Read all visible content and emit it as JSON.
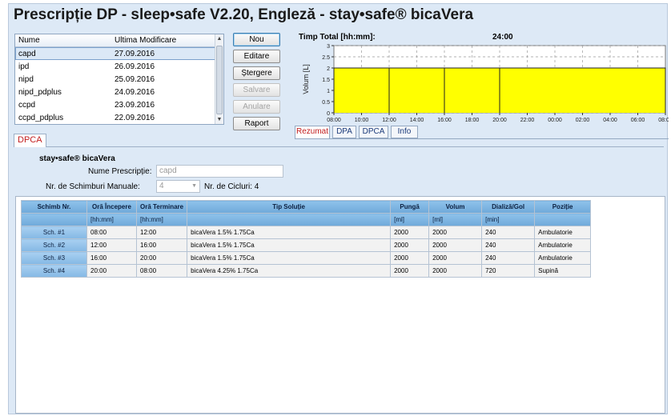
{
  "window": {
    "title": "Prescripție DP - sleep•safe V2.20, Engleză - stay•safe® bicaVera"
  },
  "prescription_list": {
    "col_name": "Nume",
    "col_modified": "Ultima Modificare",
    "rows": [
      {
        "name": "capd",
        "date": "27.09.2016"
      },
      {
        "name": "ipd",
        "date": "26.09.2016"
      },
      {
        "name": "nipd",
        "date": "25.09.2016"
      },
      {
        "name": "nipd_pdplus",
        "date": "24.09.2016"
      },
      {
        "name": "ccpd",
        "date": "23.09.2016"
      },
      {
        "name": "ccpd_pdplus",
        "date": "22.09.2016"
      }
    ]
  },
  "buttons": {
    "new": "Nou",
    "edit": "Editare",
    "delete": "Ștergere",
    "save": "Salvare",
    "cancel": "Anulare",
    "report": "Raport"
  },
  "chart": {
    "total_time_label": "Timp Total [hh:mm]:",
    "total_time_value": "24:00",
    "ylabel": "Volum [L]"
  },
  "chart_data": {
    "type": "area",
    "title": "",
    "xlabel": "",
    "ylabel": "Volum [L]",
    "x_tick_labels": [
      "08:00",
      "10:00",
      "12:00",
      "14:00",
      "16:00",
      "18:00",
      "20:00",
      "22:00",
      "00:00",
      "02:00",
      "04:00",
      "06:00",
      "08:00"
    ],
    "y_tick_labels": [
      "0",
      "0.5",
      "1",
      "1.5",
      "2",
      "2.5",
      "3"
    ],
    "ylim": [
      0,
      3
    ],
    "series": [
      {
        "values": [
          {
            "start": "08:00",
            "end": "12:00",
            "volume": 2
          },
          {
            "start": "12:00",
            "end": "16:00",
            "volume": 2
          },
          {
            "start": "16:00",
            "end": "20:00",
            "volume": 2
          },
          {
            "start": "20:00",
            "end": "08:00",
            "volume": 2
          }
        ]
      }
    ],
    "fill_color": "#ffff00",
    "grid": true
  },
  "tabs": [
    "Rezumat",
    "DPA",
    "DPCA",
    "Info"
  ],
  "mode_tab": "DPCA",
  "settings": {
    "title": "stay•safe® bicaVera",
    "name_label": "Nume Prescripție:",
    "name_value": "capd",
    "manual_label": "Nr. de Schimburi Manuale:",
    "manual_value": "4",
    "cycles_label": "Nr. de Cicluri: 4"
  },
  "exchange_table": {
    "headers": [
      "Schimb Nr.",
      "Oră Începere",
      "Oră Terminare",
      "Tip Soluție",
      "Pungă",
      "Volum",
      "Dializă/Gol",
      "Poziție"
    ],
    "units": [
      "",
      "[hh:mm]",
      "[hh:mm]",
      "",
      "[ml]",
      "[ml]",
      "[min]",
      ""
    ],
    "rows": [
      [
        "Sch. #1",
        "08:00",
        "12:00",
        "bicaVera 1.5% 1.75Ca",
        "2000",
        "2000",
        "240",
        "Ambulatorie"
      ],
      [
        "Sch. #2",
        "12:00",
        "16:00",
        "bicaVera 1.5% 1.75Ca",
        "2000",
        "2000",
        "240",
        "Ambulatorie"
      ],
      [
        "Sch. #3",
        "16:00",
        "20:00",
        "bicaVera 1.5% 1.75Ca",
        "2000",
        "2000",
        "240",
        "Ambulatorie"
      ],
      [
        "Sch. #4",
        "20:00",
        "08:00",
        "bicaVera 4.25% 1.75Ca",
        "2000",
        "2000",
        "720",
        "Supină"
      ]
    ]
  }
}
